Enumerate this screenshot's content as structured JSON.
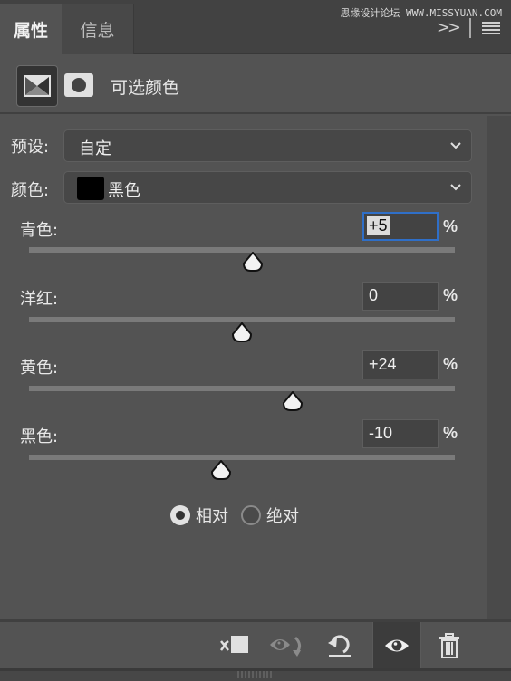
{
  "tabs": [
    {
      "label": "属性",
      "active": true
    },
    {
      "label": "信息",
      "active": false
    }
  ],
  "watermark": "思缘设计论坛 WWW.MISSYUAN.COM",
  "header": {
    "title": "可选颜色",
    "icons": [
      "adjustment-layer-icon",
      "layer-mask-icon"
    ]
  },
  "preset": {
    "label": "预设:",
    "value": "自定"
  },
  "colors": {
    "label": "颜色:",
    "value": "黑色",
    "swatch": "#000000"
  },
  "sliders": [
    {
      "label": "青色:",
      "value": "+5",
      "numeric": 5,
      "unit": "%",
      "focused": true
    },
    {
      "label": "洋红:",
      "value": "0",
      "numeric": 0,
      "unit": "%",
      "focused": false
    },
    {
      "label": "黄色:",
      "value": "+24",
      "numeric": 24,
      "unit": "%",
      "focused": false
    },
    {
      "label": "黑色:",
      "value": "-10",
      "numeric": -10,
      "unit": "%",
      "focused": false
    }
  ],
  "slider_range": [
    -100,
    100
  ],
  "method": {
    "options": [
      {
        "label": "相对",
        "selected": true
      },
      {
        "label": "绝对",
        "selected": false
      }
    ]
  },
  "footer": {
    "buttons": [
      "clip-to-layer",
      "view-previous-state",
      "reset-to-defaults",
      "toggle-visibility",
      "delete-adjustment"
    ]
  },
  "colors_theme": {
    "focus": "#2f6fc8",
    "panel": "#535353",
    "tabbar": "#424242"
  }
}
